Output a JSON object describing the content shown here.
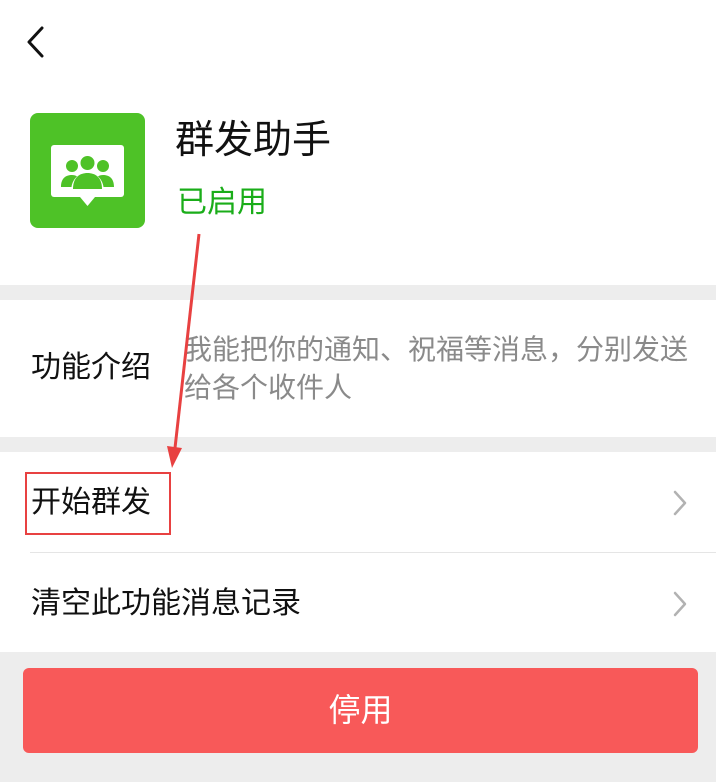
{
  "header": {
    "back_icon": "chevron-left-icon"
  },
  "app": {
    "icon": "group-chat-icon",
    "icon_color": "#4ec227",
    "title": "群发助手",
    "status": "已启用",
    "status_color": "#1aad19"
  },
  "intro": {
    "label": "功能介绍",
    "text": "我能把你的通知、祝福等消息，分别发送给各个收件人"
  },
  "menu": {
    "items": [
      {
        "label": "开始群发",
        "icon": "chevron-right-icon"
      },
      {
        "label": "清空此功能消息记录",
        "icon": "chevron-right-icon"
      }
    ]
  },
  "footer": {
    "disable_label": "停用",
    "button_color": "#f85959"
  },
  "annotation": {
    "color": "#e84141"
  }
}
